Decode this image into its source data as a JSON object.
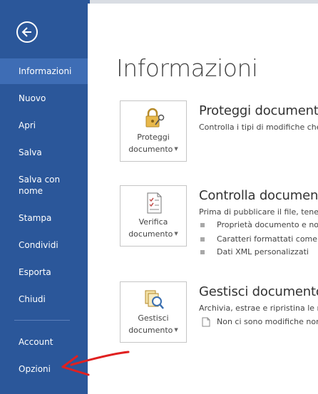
{
  "colors": {
    "sidebar": "#2b579a",
    "selected": "#3e6db5",
    "arrow": "#e02020"
  },
  "sidebar": {
    "back_icon": "arrow-left-icon",
    "items": [
      {
        "label": "Informazioni"
      },
      {
        "label": "Nuovo"
      },
      {
        "label": "Apri"
      },
      {
        "label": "Salva"
      },
      {
        "label": "Salva con nome"
      },
      {
        "label": "Stampa"
      },
      {
        "label": "Condividi"
      },
      {
        "label": "Esporta"
      },
      {
        "label": "Chiudi"
      },
      {
        "label": "Account"
      },
      {
        "label": "Opzioni"
      }
    ]
  },
  "main": {
    "title": "Informazioni",
    "sections": [
      {
        "button_line1": "Proteggi",
        "button_line2": "documento",
        "icon": "lock-key-icon",
        "title": "Proteggi documento",
        "description": "Controlla i tipi di modifiche che"
      },
      {
        "button_line1": "Verifica",
        "button_line2": "documento",
        "icon": "checklist-doc-icon",
        "title": "Controlla documento",
        "description": "Prima di pubblicare il file, tenere",
        "bullets": [
          "Proprietà documento e nom",
          "Caratteri formattati come t",
          "Dati XML personalizzati"
        ]
      },
      {
        "button_line1": "Gestisci",
        "button_line2": "documento",
        "icon": "manage-docs-icon",
        "title": "Gestisci documento",
        "description": "Archivia, estrae e ripristina le mo",
        "note": "Non ci sono modifiche non"
      }
    ]
  }
}
